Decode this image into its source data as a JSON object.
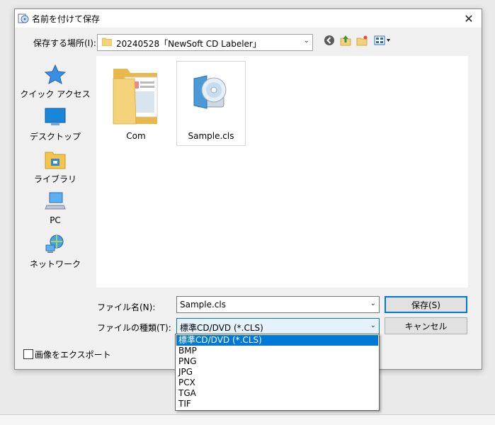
{
  "dialog": {
    "title": "名前を付けて保存",
    "close": "✕"
  },
  "location": {
    "label": "保存する場所(I):",
    "value": "20240528「NewSoft CD Labeler」"
  },
  "toolbar": {
    "icons": [
      "back-icon",
      "up-folder-icon",
      "new-folder-icon",
      "view-menu-icon"
    ]
  },
  "places": [
    {
      "label": "クイック アクセス",
      "icon": "star-icon"
    },
    {
      "label": "デスクトップ",
      "icon": "desktop-icon"
    },
    {
      "label": "ライブラリ",
      "icon": "library-icon"
    },
    {
      "label": "PC",
      "icon": "pc-icon"
    },
    {
      "label": "ネットワーク",
      "icon": "network-icon"
    }
  ],
  "files": [
    {
      "name": "Com",
      "icon": "folder-icon"
    },
    {
      "name": "Sample.cls",
      "icon": "cd-file-icon"
    }
  ],
  "filename": {
    "label": "ファイル名(N):",
    "value": "Sample.cls"
  },
  "filetype": {
    "label": "ファイルの種類(T):",
    "value": "標準CD/DVD (*.CLS)",
    "options": [
      "標準CD/DVD (*.CLS)",
      "BMP",
      "PNG",
      "JPG",
      "PCX",
      "TGA",
      "TIF"
    ]
  },
  "buttons": {
    "save": "保存(S)",
    "cancel": "キャンセル"
  },
  "export": {
    "label": "画像をエクスポート"
  },
  "colors": {
    "accent": "#0078d7",
    "folder": "#f3d27a"
  }
}
